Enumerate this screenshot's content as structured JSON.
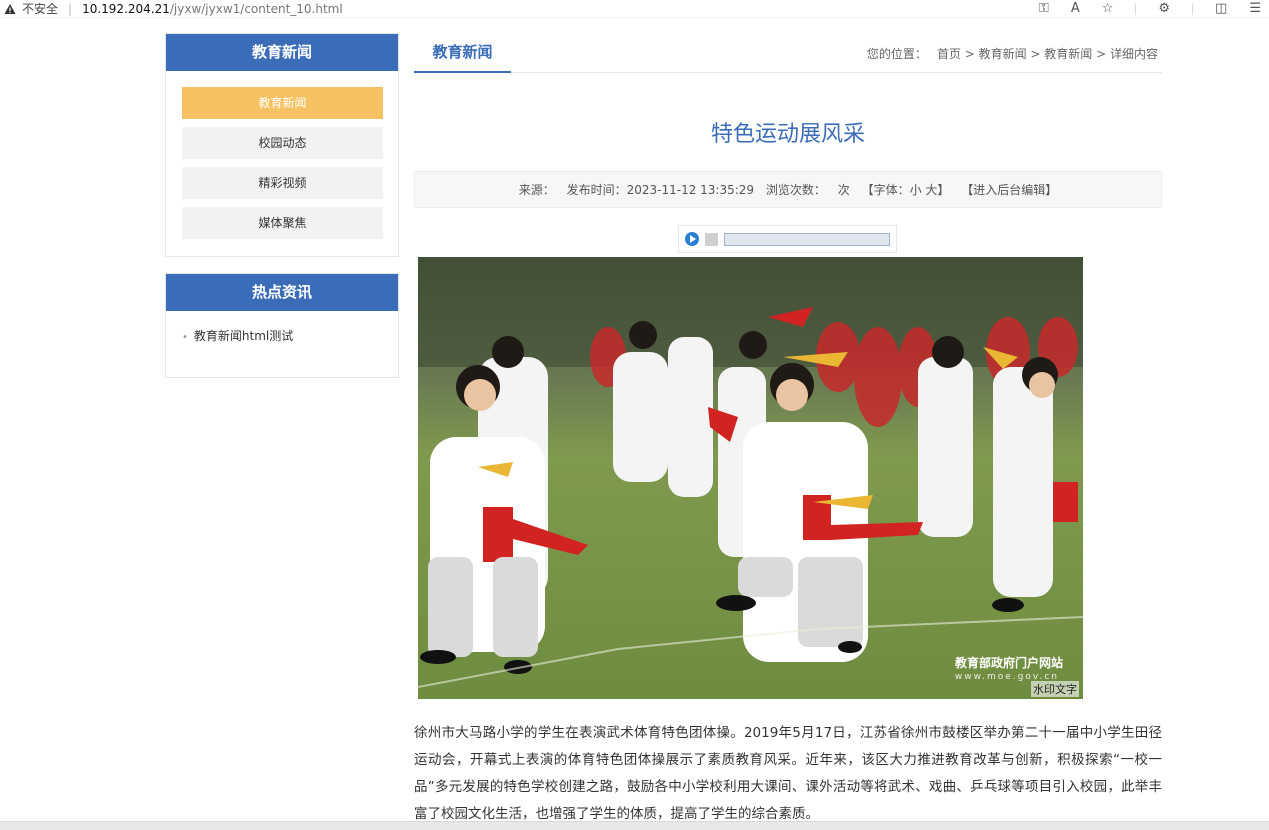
{
  "browser": {
    "insecure_label": "不安全",
    "url_host": "10.192.204.21",
    "url_path": "/jyxw/jyxw1/content_10.html",
    "icons": [
      "key-icon",
      "read-aloud-icon",
      "favorite-star-icon",
      "extensions-icon",
      "split-screen-icon",
      "favorites-list-icon"
    ]
  },
  "sidebar": {
    "section_title": "教育新闻",
    "items": [
      {
        "label": "教育新闻",
        "active": true
      },
      {
        "label": "校园动态",
        "active": false
      },
      {
        "label": "精彩视频",
        "active": false
      },
      {
        "label": "媒体聚焦",
        "active": false
      }
    ],
    "hot": {
      "title": "热点资讯",
      "items": [
        "教育新闻html测试"
      ]
    }
  },
  "main": {
    "tab_label": "教育新闻",
    "breadcrumb": {
      "label": "您的位置：",
      "path": "首页 > 教育新闻 > 教育新闻 > 详细内容"
    },
    "article": {
      "title": "特色运动展风采",
      "meta": {
        "source": "来源：",
        "published": "发布时间：2023-11-12 13:35:29",
        "views": "浏览次数：",
        "views_unit": "次",
        "font_size": "【字体：小 大】",
        "edit": "【进入后台编辑】"
      },
      "watermark": {
        "site": "教育部政府门户网站",
        "domain": "www.moe.gov.cn",
        "text": "水印文字"
      },
      "body": "徐州市大马路小学的学生在表演武术体育特色团体操。2019年5月17日，江苏省徐州市鼓楼区举办第二十一届中小学生田径运动会，开幕式上表演的体育特色团体操展示了素质教育风采。近年来，该区大力推进教育改革与创新，积极探索“一校一品”多元发展的特色学校创建之路，鼓励各中小学校利用大课间、课外活动等将武术、戏曲、乒乓球等项目引入校园，此举丰富了校园文化生活，也增强了学生的体质，提高了学生的综合素质。"
    }
  },
  "colors": {
    "brand_blue": "#3b6cb7",
    "active_orange": "#f6c161"
  }
}
